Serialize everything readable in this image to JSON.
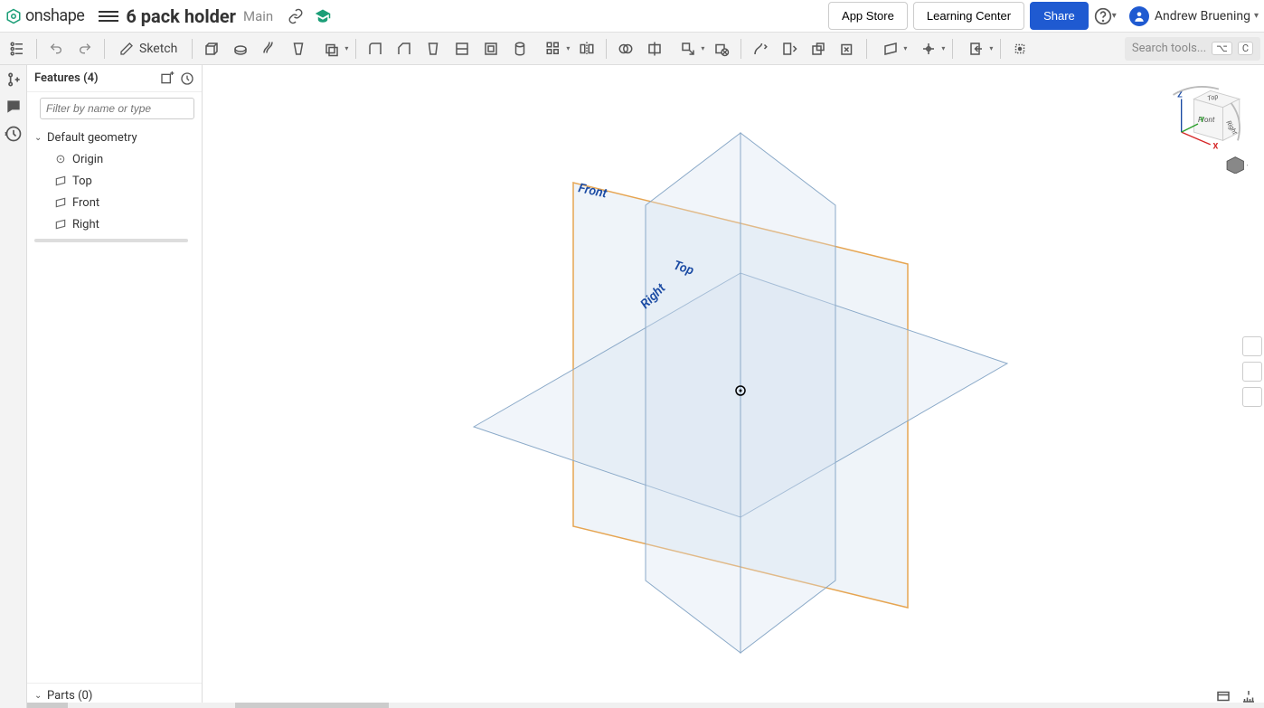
{
  "header": {
    "app_name": "onshape",
    "doc_title": "6 pack holder",
    "doc_tab": "Main",
    "app_store": "App Store",
    "learning_center": "Learning Center",
    "share": "Share",
    "user_name": "Andrew Bruening"
  },
  "toolbar": {
    "sketch": "Sketch",
    "search_placeholder": "Search tools...",
    "search_key1": "⌥",
    "search_key2": "C"
  },
  "panel": {
    "features_title": "Features (4)",
    "filter_placeholder": "Filter by name or type",
    "tree": {
      "default_geometry": "Default geometry",
      "origin": "Origin",
      "top": "Top",
      "front": "Front",
      "right": "Right"
    },
    "parts_title": "Parts (0)"
  },
  "canvas": {
    "plane_front": "Front",
    "plane_top": "Top",
    "plane_right": "Right",
    "axis_x": "X",
    "axis_y": "Y",
    "axis_z": "Z",
    "cube_front": "Front",
    "cube_top": "Top",
    "cube_right": "Right"
  }
}
